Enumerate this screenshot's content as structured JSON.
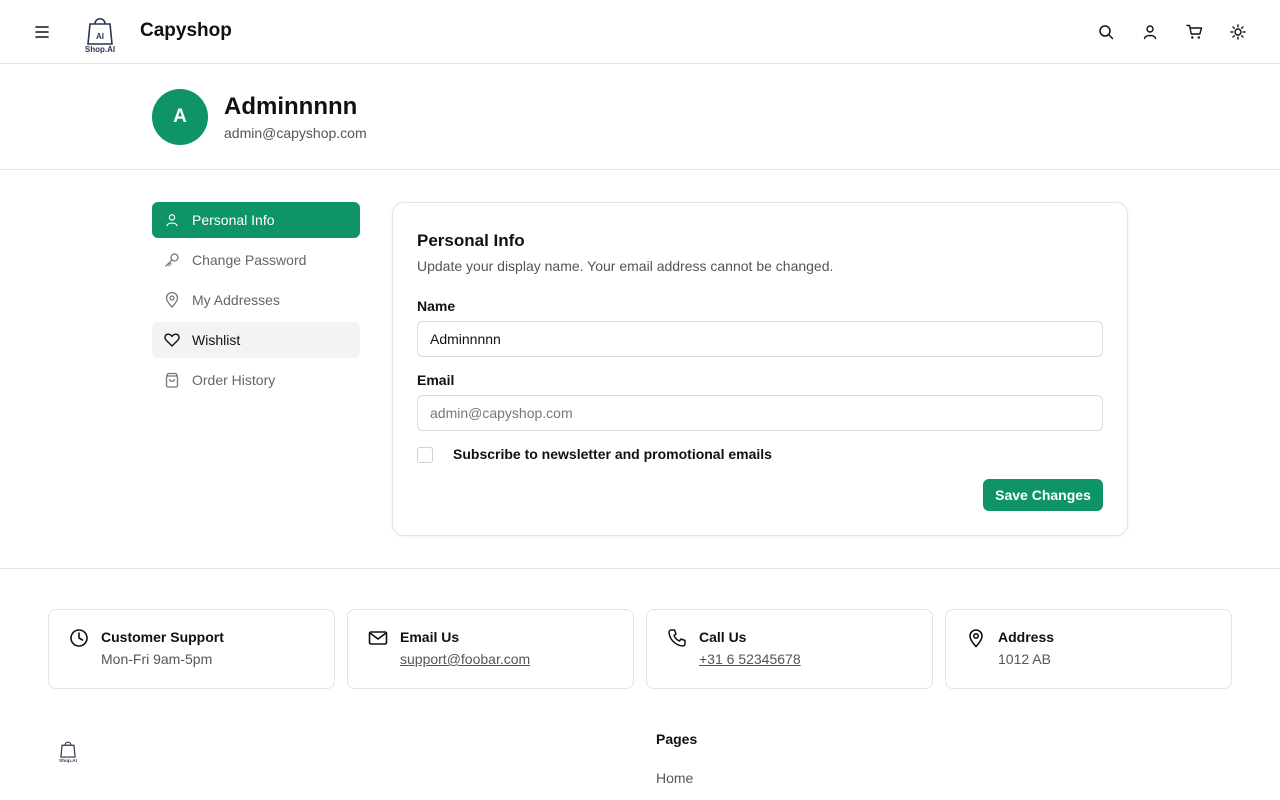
{
  "header": {
    "brand": "Capyshop",
    "logo_text": "Shop.AI"
  },
  "profile": {
    "avatar_initial": "A",
    "name": "Adminnnnn",
    "email": "admin@capyshop.com"
  },
  "sidebar": {
    "items": [
      {
        "label": "Personal Info",
        "icon": "user-icon",
        "state": "active"
      },
      {
        "label": "Change Password",
        "icon": "key-icon",
        "state": "normal"
      },
      {
        "label": "My Addresses",
        "icon": "map-pin-icon",
        "state": "normal"
      },
      {
        "label": "Wishlist",
        "icon": "heart-icon",
        "state": "hover"
      },
      {
        "label": "Order History",
        "icon": "shopping-bag-icon",
        "state": "normal"
      }
    ]
  },
  "form": {
    "title": "Personal Info",
    "subtitle": "Update your display name. Your email address cannot be changed.",
    "name_label": "Name",
    "name_value": "Adminnnnn",
    "email_label": "Email",
    "email_value": "admin@capyshop.com",
    "newsletter_label": "Subscribe to newsletter and promotional emails",
    "newsletter_checked": false,
    "save_label": "Save Changes"
  },
  "footer": {
    "cards": [
      {
        "title": "Customer Support",
        "value": "Mon-Fri 9am-5pm",
        "icon": "clock-icon"
      },
      {
        "title": "Email Us",
        "value": "support@foobar.com",
        "icon": "mail-icon"
      },
      {
        "title": "Call Us",
        "value": "+31 6 52345678",
        "icon": "phone-icon"
      },
      {
        "title": "Address",
        "value": "1012 AB",
        "icon": "map-pin-icon"
      }
    ],
    "pages_title": "Pages",
    "pages_links": [
      "Home"
    ]
  },
  "colors": {
    "accent": "#0f9466",
    "border": "#e3e3e3",
    "muted_text": "#555555"
  }
}
